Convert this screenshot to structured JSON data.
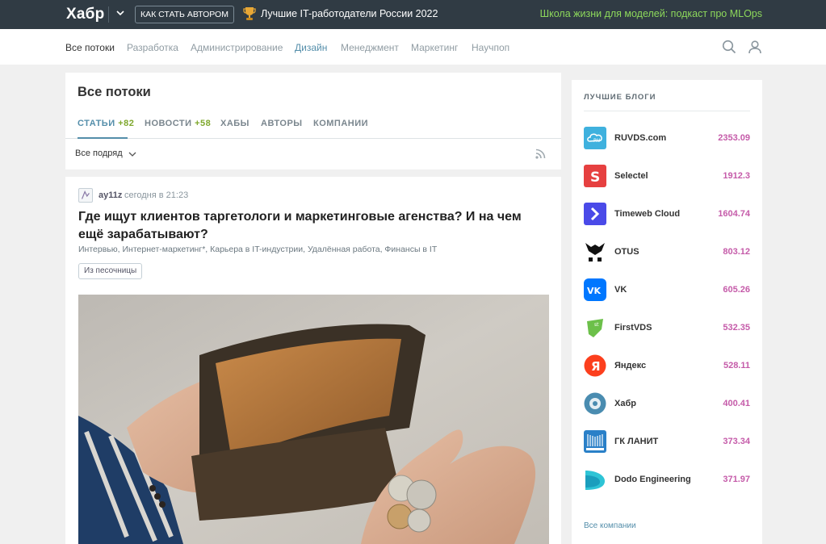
{
  "topbar": {
    "logo": "Хабр",
    "author_button": "КАК СТАТЬ АВТОРОМ",
    "promo_center": "Лучшие IT-работодатели России 2022",
    "promo_right": "Школа жизни для моделей: подкаст про MLOps"
  },
  "nav": {
    "items": [
      "Все потоки",
      "Разработка",
      "Администрирование",
      "Дизайн",
      "Менеджмент",
      "Маркетинг",
      "Научпоп"
    ]
  },
  "feed": {
    "title": "Все потоки",
    "tabs": [
      {
        "label": "СТАТЬИ",
        "count": "+82"
      },
      {
        "label": "НОВОСТИ",
        "count": "+58"
      },
      {
        "label": "ХАБЫ"
      },
      {
        "label": "АВТОРЫ"
      },
      {
        "label": "КОМПАНИИ"
      }
    ],
    "filter": "Все подряд"
  },
  "article": {
    "author": "ay11z",
    "time": "сегодня в 21:23",
    "title": "Где ищут клиентов таргетологи и маркетинговые агенства? И на чем ещё зарабатывают?",
    "hubs": "Интервью, Интернет-маркетинг*, Карьера в IT-индустрии, Удалённая работа, Финансы в IT",
    "badge": "Из песочницы"
  },
  "sidebar": {
    "title": "ЛУЧШИЕ БЛОГИ",
    "blogs": [
      {
        "name": "RUVDS.com",
        "score": "2353.09",
        "color": "#3fb1de"
      },
      {
        "name": "Selectel",
        "score": "1912.3",
        "color": "#e64040"
      },
      {
        "name": "Timeweb Cloud",
        "score": "1604.74",
        "color": "#4a4ae8"
      },
      {
        "name": "OTUS",
        "score": "803.12",
        "color": "#111111"
      },
      {
        "name": "VK",
        "score": "605.26",
        "color": "#0077ff"
      },
      {
        "name": "FirstVDS",
        "score": "532.35",
        "color": "#6cc04a"
      },
      {
        "name": "Яндекс",
        "score": "528.11",
        "color": "#fc3f1d"
      },
      {
        "name": "Хабр",
        "score": "400.41",
        "color": "#4a8cb0"
      },
      {
        "name": "ГК ЛАНИТ",
        "score": "373.34",
        "color": "#2a80c8"
      },
      {
        "name": "Dodo Engineering",
        "score": "371.97",
        "color": "#2ec4d6"
      }
    ],
    "all_companies": "Все компании"
  }
}
